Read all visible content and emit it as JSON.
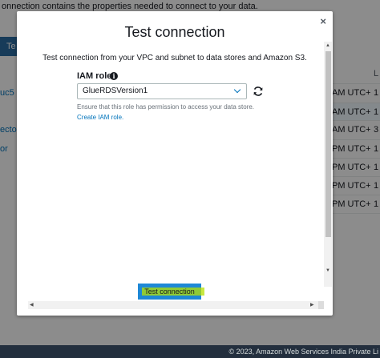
{
  "background": {
    "header_text": "onnection contains the properties needed to connect to your data.",
    "tab_label": "Te",
    "left_links": [
      "uc5",
      "ector",
      "or"
    ],
    "column_header": "L",
    "rows": [
      {
        "time": "AM UTC+",
        "num": "1"
      },
      {
        "time": "AM UTC+",
        "num": "1"
      },
      {
        "time": "AM UTC+",
        "num": "3"
      },
      {
        "time": "PM UTC+",
        "num": "1"
      },
      {
        "time": "PM UTC+",
        "num": "1"
      },
      {
        "time": "PM UTC+",
        "num": "1"
      },
      {
        "time": "PM UTC+",
        "num": "1"
      }
    ]
  },
  "modal": {
    "title": "Test connection",
    "close_label": "×",
    "description": "Test connection from your VPC and subnet to data stores and Amazon S3.",
    "iam_role_label": "IAM role",
    "info_icon": "info-icon",
    "selected_role": "GlueRDSVersion1",
    "hint": "Ensure that this role has permission to access your data store.",
    "create_link": "Create IAM role.",
    "test_button": "Test connection"
  },
  "footer": {
    "copyright": "© 2023, Amazon Web Services India Private Li"
  }
}
